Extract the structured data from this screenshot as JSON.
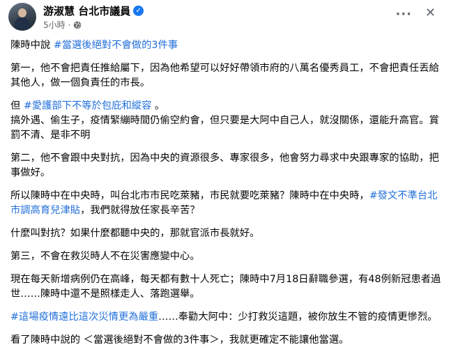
{
  "post": {
    "author": "游淑慧 台北市議員",
    "verified_icon": "verified-badge-icon",
    "time": "5小時",
    "dot": "·",
    "privacy_icon": "globe-icon",
    "more_label": "···",
    "close_label": "✕",
    "paragraphs": [
      {
        "lines": [
          {
            "text": "陳時中說 "
          },
          {
            "text": "#當選後絕對不會做的3件事",
            "tag": true
          }
        ]
      },
      {
        "lines": [
          {
            "text": "第一，他不會把責任推給屬下，因為他希望可以好好帶領市府的八萬名優秀員工，不會把責任丟給其他人，做一個負責任的市長。"
          }
        ]
      },
      {
        "lines": [
          {
            "text": "但 "
          },
          {
            "text": "#愛護部下不等於包庇和縱容",
            "tag": true
          },
          {
            "text": " 。"
          },
          {
            "text": "\n搞外遇、偷生子，疫情緊繃時間仍偷空約會，但只要是大阿中自己人，就沒關係，還能升高官。賞罰不清、是非不明"
          }
        ]
      },
      {
        "lines": [
          {
            "text": "第二，他不會跟中央對抗，因為中央的資源很多、專家很多，他會努力尋求中央跟專家的協助，把事做好。"
          }
        ]
      },
      {
        "lines": [
          {
            "text": "所以陳時中在中央時，叫台北市市民吃萊豬，市民就要吃萊豬？陳時中在中央時，"
          },
          {
            "text": "#發文不準台北市調高育兒津貼",
            "tag": true
          },
          {
            "text": "，我們就得放任家長辛苦？"
          }
        ]
      },
      {
        "lines": [
          {
            "text": "什麼叫對抗？如果什麼都聽中央的，那就官派市長就好。"
          }
        ]
      },
      {
        "lines": [
          {
            "text": "第三，不會在救災時人不在災害應變中心。"
          }
        ]
      },
      {
        "lines": [
          {
            "text": "現在每天新增病例仍在高峰，每天都有數十人死亡；陳時中7月18日辭職參選，有48例新冠患者過世……陳時中還不是照樣走人、落跑選舉。"
          }
        ]
      },
      {
        "lines": [
          {
            "text": "#這場疫情遠比這次災情更為嚴重",
            "tag": true
          },
          {
            "text": "……奉勸大阿中：少打救災這題，被你放生不管的疫情更慘烈。"
          }
        ]
      },
      {
        "lines": [
          {
            "text": "看了陳時中說的 ＜當選後絕對不會做的3件事＞，我就更確定不能讓他當選。"
          }
        ]
      }
    ]
  }
}
